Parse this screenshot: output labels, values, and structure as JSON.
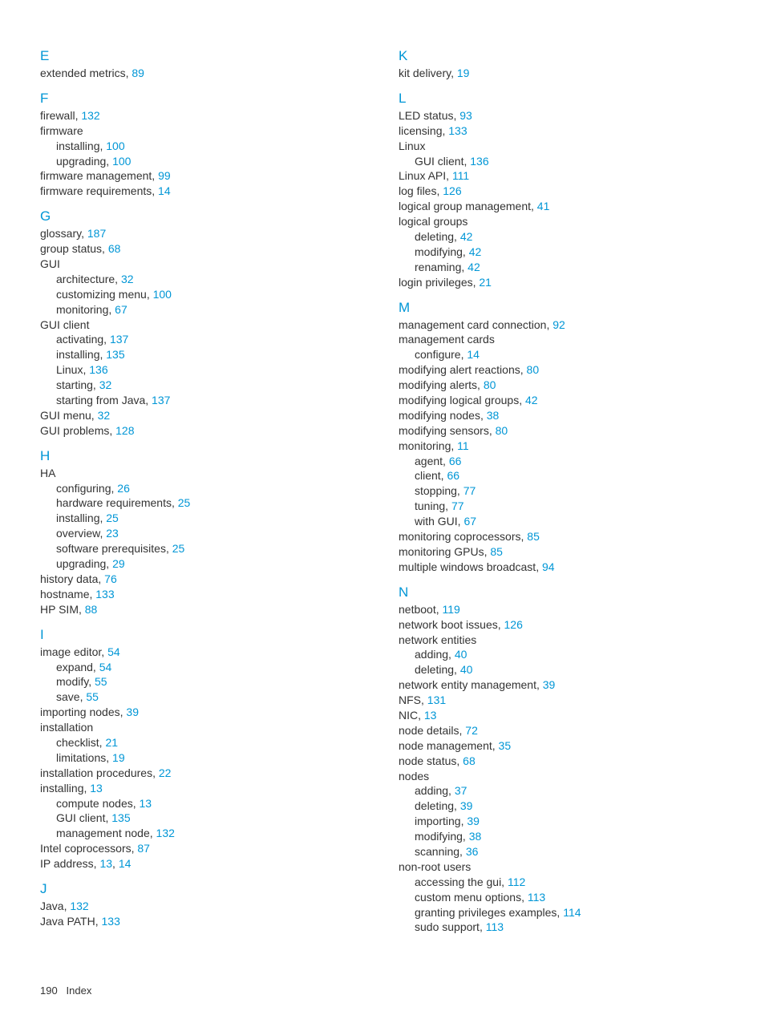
{
  "footer": {
    "pageNumber": "190",
    "label": "Index"
  },
  "columns": [
    {
      "sections": [
        {
          "letter": "E",
          "entries": [
            {
              "text": "extended metrics, ",
              "page": "89"
            }
          ]
        },
        {
          "letter": "F",
          "entries": [
            {
              "text": "firewall, ",
              "page": "132"
            },
            {
              "text": "firmware"
            },
            {
              "text": "installing, ",
              "page": "100",
              "sub": true
            },
            {
              "text": "upgrading, ",
              "page": "100",
              "sub": true
            },
            {
              "text": "firmware management, ",
              "page": "99"
            },
            {
              "text": "firmware requirements, ",
              "page": "14"
            }
          ]
        },
        {
          "letter": "G",
          "entries": [
            {
              "text": "glossary, ",
              "page": "187"
            },
            {
              "text": "group status, ",
              "page": "68"
            },
            {
              "text": "GUI"
            },
            {
              "text": "architecture, ",
              "page": "32",
              "sub": true
            },
            {
              "text": "customizing menu, ",
              "page": "100",
              "sub": true
            },
            {
              "text": "monitoring, ",
              "page": "67",
              "sub": true
            },
            {
              "text": "GUI client"
            },
            {
              "text": "activating, ",
              "page": "137",
              "sub": true
            },
            {
              "text": "installing, ",
              "page": "135",
              "sub": true
            },
            {
              "text": "Linux, ",
              "page": "136",
              "sub": true
            },
            {
              "text": "starting, ",
              "page": "32",
              "sub": true
            },
            {
              "text": "starting from Java, ",
              "page": "137",
              "sub": true
            },
            {
              "text": "GUI menu, ",
              "page": "32"
            },
            {
              "text": "GUI problems, ",
              "page": "128"
            }
          ]
        },
        {
          "letter": "H",
          "entries": [
            {
              "text": "HA"
            },
            {
              "text": "configuring, ",
              "page": "26",
              "sub": true
            },
            {
              "text": "hardware requirements, ",
              "page": "25",
              "sub": true
            },
            {
              "text": "installing, ",
              "page": "25",
              "sub": true
            },
            {
              "text": "overview, ",
              "page": "23",
              "sub": true
            },
            {
              "text": "software prerequisites, ",
              "page": "25",
              "sub": true
            },
            {
              "text": "upgrading, ",
              "page": "29",
              "sub": true
            },
            {
              "text": "history data, ",
              "page": "76"
            },
            {
              "text": "hostname, ",
              "page": "133"
            },
            {
              "text": "HP SIM, ",
              "page": "88"
            }
          ]
        },
        {
          "letter": "I",
          "entries": [
            {
              "text": "image editor, ",
              "page": "54"
            },
            {
              "text": "expand, ",
              "page": "54",
              "sub": true
            },
            {
              "text": "modify, ",
              "page": "55",
              "sub": true
            },
            {
              "text": "save, ",
              "page": "55",
              "sub": true
            },
            {
              "text": "importing nodes, ",
              "page": "39"
            },
            {
              "text": "installation"
            },
            {
              "text": "checklist, ",
              "page": "21",
              "sub": true
            },
            {
              "text": "limitations, ",
              "page": "19",
              "sub": true
            },
            {
              "text": "installation procedures, ",
              "page": "22"
            },
            {
              "text": "installing, ",
              "page": "13"
            },
            {
              "text": "compute nodes, ",
              "page": "13",
              "sub": true
            },
            {
              "text": "GUI client, ",
              "page": "135",
              "sub": true
            },
            {
              "text": "management node, ",
              "page": "132",
              "sub": true
            },
            {
              "text": "Intel coprocessors, ",
              "page": "87"
            },
            {
              "text": "IP address, ",
              "pages": [
                "13",
                "14"
              ]
            }
          ]
        },
        {
          "letter": "J",
          "entries": [
            {
              "text": "Java, ",
              "page": "132"
            },
            {
              "text": "Java PATH, ",
              "page": "133"
            }
          ]
        }
      ]
    },
    {
      "sections": [
        {
          "letter": "K",
          "entries": [
            {
              "text": "kit delivery, ",
              "page": "19"
            }
          ]
        },
        {
          "letter": "L",
          "entries": [
            {
              "text": "LED status, ",
              "page": "93"
            },
            {
              "text": "licensing, ",
              "page": "133"
            },
            {
              "text": "Linux"
            },
            {
              "text": "GUI client, ",
              "page": "136",
              "sub": true
            },
            {
              "text": "Linux API, ",
              "page": "111"
            },
            {
              "text": "log files, ",
              "page": "126"
            },
            {
              "text": "logical group management, ",
              "page": "41"
            },
            {
              "text": "logical groups"
            },
            {
              "text": "deleting, ",
              "page": "42",
              "sub": true
            },
            {
              "text": "modifying, ",
              "page": "42",
              "sub": true
            },
            {
              "text": "renaming, ",
              "page": "42",
              "sub": true
            },
            {
              "text": "login privileges, ",
              "page": "21"
            }
          ]
        },
        {
          "letter": "M",
          "entries": [
            {
              "text": "management card connection, ",
              "page": "92"
            },
            {
              "text": "management cards"
            },
            {
              "text": "configure, ",
              "page": "14",
              "sub": true
            },
            {
              "text": "modifying alert reactions, ",
              "page": "80"
            },
            {
              "text": "modifying alerts, ",
              "page": "80"
            },
            {
              "text": "modifying logical groups, ",
              "page": "42"
            },
            {
              "text": "modifying nodes, ",
              "page": "38"
            },
            {
              "text": "modifying sensors, ",
              "page": "80"
            },
            {
              "text": "monitoring, ",
              "page": "11"
            },
            {
              "text": "agent, ",
              "page": "66",
              "sub": true
            },
            {
              "text": "client, ",
              "page": "66",
              "sub": true
            },
            {
              "text": "stopping, ",
              "page": "77",
              "sub": true
            },
            {
              "text": "tuning, ",
              "page": "77",
              "sub": true
            },
            {
              "text": "with GUI, ",
              "page": "67",
              "sub": true
            },
            {
              "text": "monitoring coprocessors, ",
              "page": "85"
            },
            {
              "text": "monitoring GPUs, ",
              "page": "85"
            },
            {
              "text": "multiple windows broadcast, ",
              "page": "94"
            }
          ]
        },
        {
          "letter": "N",
          "entries": [
            {
              "text": "netboot, ",
              "page": "119"
            },
            {
              "text": "network boot issues, ",
              "page": "126"
            },
            {
              "text": "network entities"
            },
            {
              "text": "adding, ",
              "page": "40",
              "sub": true
            },
            {
              "text": "deleting, ",
              "page": "40",
              "sub": true
            },
            {
              "text": "network entity management, ",
              "page": "39"
            },
            {
              "text": "NFS, ",
              "page": "131"
            },
            {
              "text": "NIC, ",
              "page": "13"
            },
            {
              "text": "node details, ",
              "page": "72"
            },
            {
              "text": "node management, ",
              "page": "35"
            },
            {
              "text": "node status, ",
              "page": "68"
            },
            {
              "text": "nodes"
            },
            {
              "text": "adding, ",
              "page": "37",
              "sub": true
            },
            {
              "text": "deleting, ",
              "page": "39",
              "sub": true
            },
            {
              "text": "importing, ",
              "page": "39",
              "sub": true
            },
            {
              "text": "modifying, ",
              "page": "38",
              "sub": true
            },
            {
              "text": "scanning, ",
              "page": "36",
              "sub": true
            },
            {
              "text": "non-root users"
            },
            {
              "text": "accessing the gui, ",
              "page": "112",
              "sub": true
            },
            {
              "text": "custom menu options, ",
              "page": "113",
              "sub": true
            },
            {
              "text": "granting privileges examples, ",
              "page": "114",
              "sub": true
            },
            {
              "text": "sudo support, ",
              "page": "113",
              "sub": true
            }
          ]
        }
      ]
    }
  ]
}
